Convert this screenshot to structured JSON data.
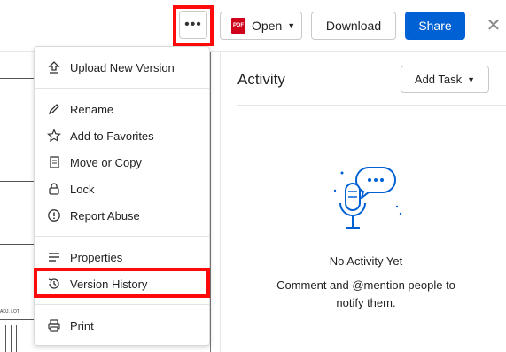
{
  "toolbar": {
    "more_label": "•••",
    "open_label": "Open",
    "pdf_badge": "PDF",
    "download_label": "Download",
    "share_label": "Share",
    "close_label": "✕"
  },
  "preview": {
    "note": "ADJ. LOT"
  },
  "menu": {
    "upload_new_version": "Upload New Version",
    "rename": "Rename",
    "add_to_favorites": "Add to Favorites",
    "move_or_copy": "Move or Copy",
    "lock": "Lock",
    "report_abuse": "Report Abuse",
    "properties": "Properties",
    "version_history": "Version History",
    "print": "Print"
  },
  "activity": {
    "title": "Activity",
    "add_task_label": "Add Task",
    "empty_title": "No Activity Yet",
    "empty_text": "Comment and @mention people to notify them."
  },
  "colors": {
    "accent": "#0061d5",
    "highlight": "#ff0a0a",
    "pdf": "#d0021b"
  }
}
